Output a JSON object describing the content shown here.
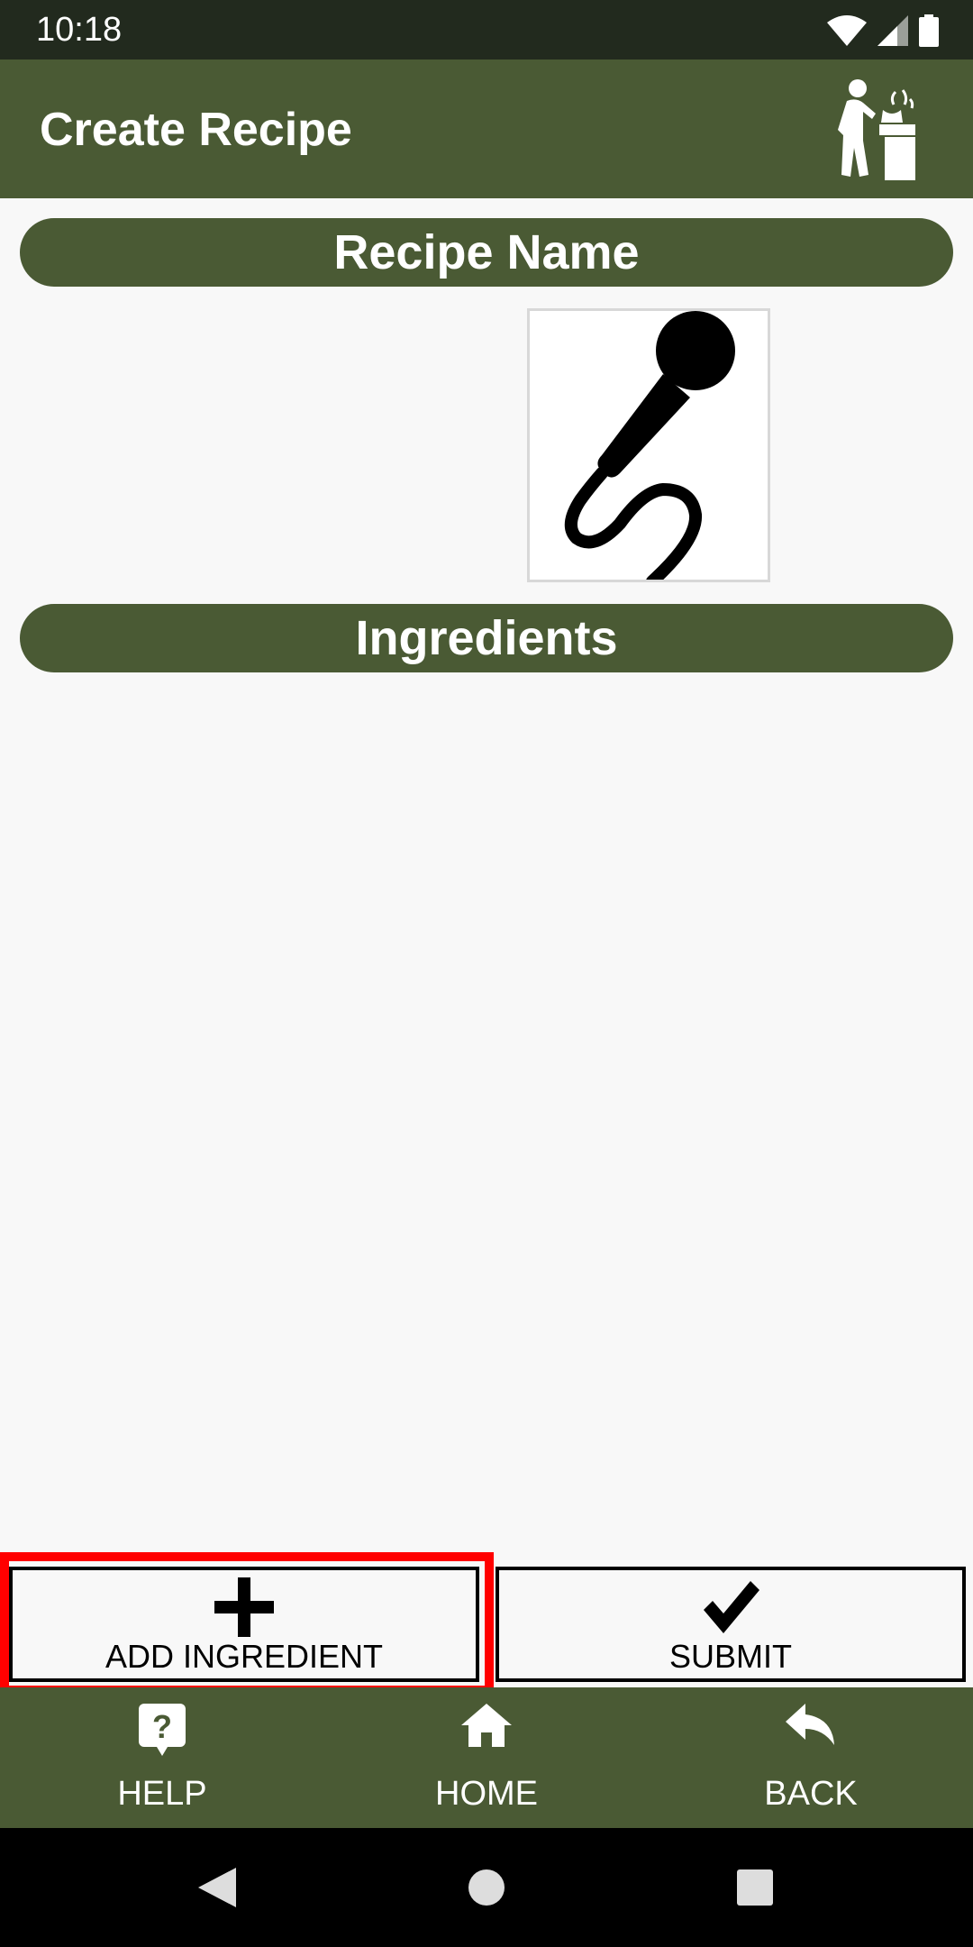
{
  "status_bar": {
    "time": "10:18",
    "icons": [
      "wifi-icon",
      "cell-signal-icon",
      "battery-icon"
    ]
  },
  "app_bar": {
    "title": "Create Recipe",
    "icon": "chef-cooking-icon"
  },
  "form": {
    "recipe_name_label": "Recipe Name",
    "voice_input_icon": "microphone-icon",
    "ingredients_label": "Ingredients"
  },
  "actions": {
    "add_ingredient_label": "ADD INGREDIENT",
    "add_ingredient_icon": "plus-icon",
    "submit_label": "SUBMIT",
    "submit_icon": "checkmark-icon",
    "highlighted": "add_ingredient"
  },
  "bottom_nav": {
    "items": [
      {
        "label": "HELP",
        "icon": "help-icon"
      },
      {
        "label": "HOME",
        "icon": "home-icon"
      },
      {
        "label": "BACK",
        "icon": "reply-back-icon"
      }
    ]
  },
  "colors": {
    "primary": "#4a5a34",
    "status_bar": "#222a1e",
    "background": "#f8f8f8",
    "highlight": "#ff0000"
  }
}
